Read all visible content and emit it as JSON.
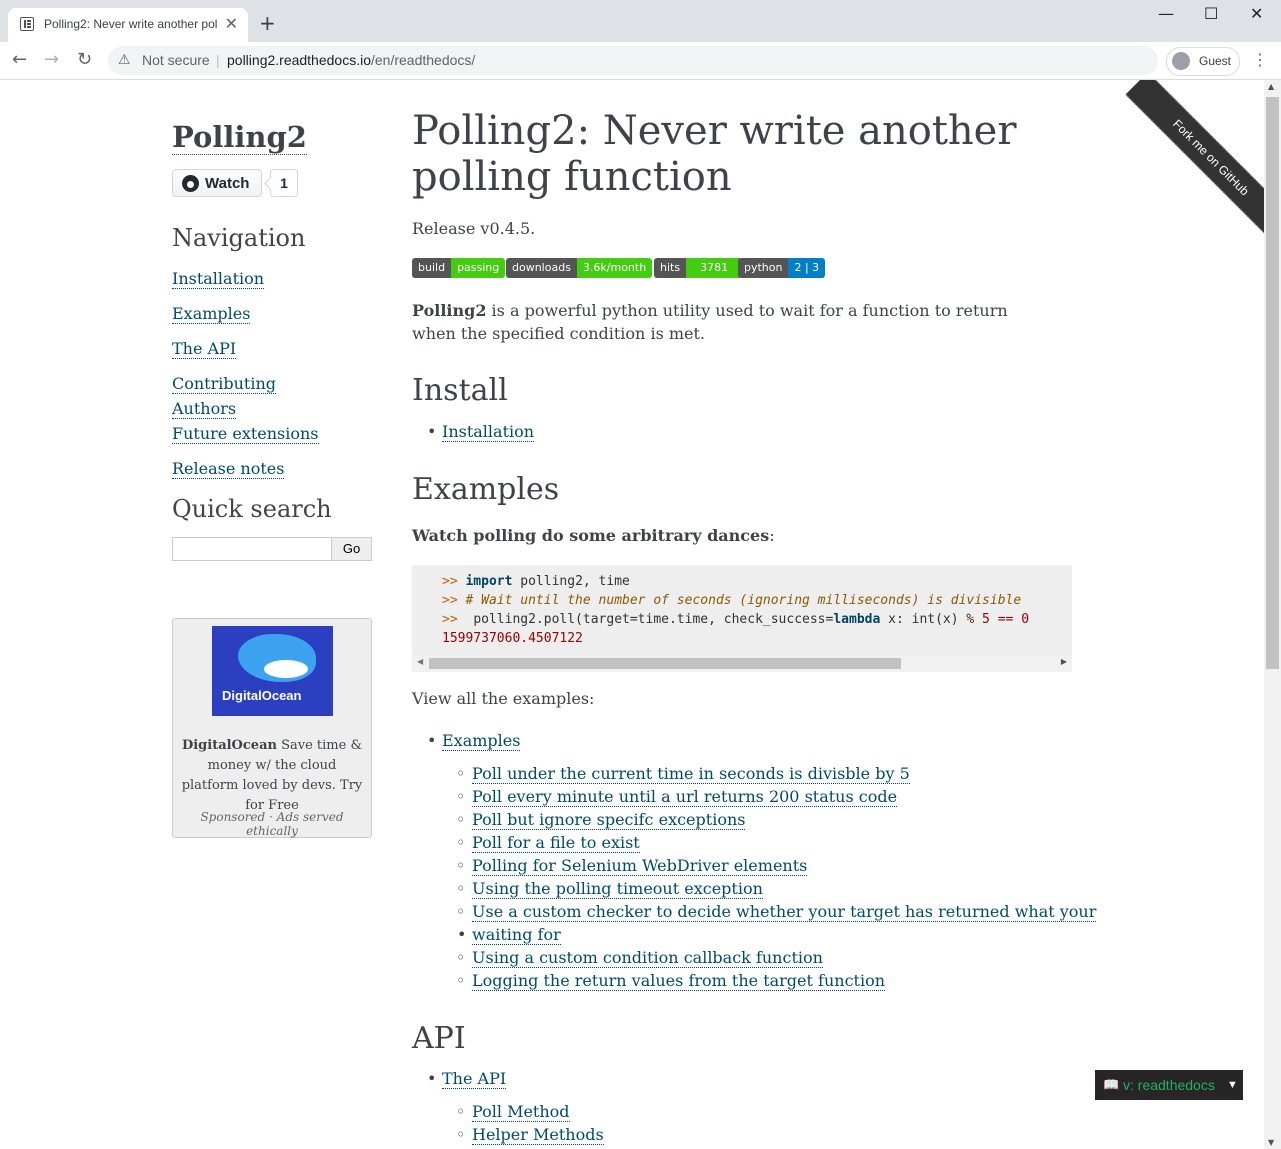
{
  "browser": {
    "tab_title": "Polling2: Never write another pol",
    "new_tab": "+",
    "not_secure": "Not secure",
    "url_host": "polling2.readthedocs.io",
    "url_path": "/en/readthedocs/",
    "profile": "Guest"
  },
  "sidebar": {
    "logo": "Polling2",
    "watch_label": "Watch",
    "watch_count": "1",
    "nav_heading": "Navigation",
    "nav_items": [
      {
        "label": "Installation"
      },
      {
        "label": "Examples"
      },
      {
        "label": "The API"
      },
      {
        "label": "Contributing"
      },
      {
        "label": "Authors"
      },
      {
        "label": "Future extensions"
      },
      {
        "label": "Release notes"
      }
    ],
    "search_heading": "Quick search",
    "search_button": "Go",
    "ad": {
      "brand_image_text": "DigitalOcean",
      "brand": "DigitalOcean",
      "text": "Save time & money w/ the cloud platform loved by devs. Try for Free",
      "footer": "Sponsored · Ads served ethically"
    }
  },
  "main": {
    "title": "Polling2: Never write another polling function",
    "release": "Release v0.4.5.",
    "badges": [
      {
        "left": "build",
        "right": "passing",
        "color": "#4c1"
      },
      {
        "left": "downloads",
        "right": "3.6k/month",
        "color": "#4c1"
      },
      {
        "left": "hits",
        "right": "3781",
        "color": "#4c1"
      },
      {
        "left": "python",
        "right": "2 | 3",
        "color": "#007ec6"
      }
    ],
    "intro_bold": "Polling2",
    "intro_rest": " is a powerful python utility used to wait for a function to return when the specified condition is met.",
    "install_heading": "Install",
    "install_link": "Installation",
    "examples_heading": "Examples",
    "examples_intro": "Watch polling do some arbitrary dances",
    "examples_intro_colon": ":",
    "code": {
      "line1_prompt": ">> ",
      "line1_kw": "import",
      "line1_rest": " polling2, time",
      "line2_prompt": ">> ",
      "line2_comment": "# Wait until the number of seconds (ignoring milliseconds) is divisible",
      "line3_prompt": ">>  ",
      "line3_a": "polling2.poll(target=time.time, check_success=",
      "line3_kw": "lambda",
      "line3_b": " x: int(x) ",
      "line3_op": "%",
      "line3_c": " 5 == 0",
      "line4_output": "1599737060.4507122"
    },
    "view_all": "View all the examples:",
    "examples_link": "Examples",
    "example_items": [
      {
        "label": "Poll under the current time in seconds is divisble by 5"
      },
      {
        "label": "Poll every minute until a url returns 200 status code"
      },
      {
        "label": "Poll but ignore specifc exceptions"
      },
      {
        "label": "Poll for a file to exist"
      },
      {
        "label": "Polling for Selenium WebDriver elements"
      },
      {
        "label": "Using the polling timeout exception"
      },
      {
        "label": "Use a custom checker to decide whether your target has returned what your"
      },
      {
        "label": "waiting for"
      },
      {
        "label": "Using a custom condition callback function"
      },
      {
        "label": "Logging the return values from the target function"
      }
    ],
    "api_heading": "API",
    "api_link": "The API",
    "api_items": [
      {
        "label": "Poll Method"
      },
      {
        "label": "Helper Methods"
      }
    ]
  },
  "ribbon": "Fork me on GitHub",
  "version_badge": "v: readthedocs"
}
